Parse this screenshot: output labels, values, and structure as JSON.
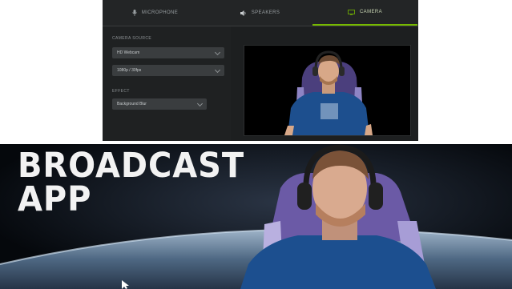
{
  "app": {
    "tabs": [
      {
        "label": "MICROPHONE",
        "icon": "microphone-icon"
      },
      {
        "label": "SPEAKERS",
        "icon": "speaker-icon"
      },
      {
        "label": "CAMERA",
        "icon": "camera-icon",
        "active": true
      }
    ],
    "source_device_label": "CAMERA SOURCE",
    "device_select": "HD Webcam",
    "resolution_select": "1080p / 30fps",
    "effect_label": "EFFECT",
    "effect_select": "Background Blur",
    "effect_enabled": true,
    "accent_color": "#76b900"
  },
  "banner": {
    "title_line1": "BROADCAST",
    "title_line2": "APP"
  }
}
